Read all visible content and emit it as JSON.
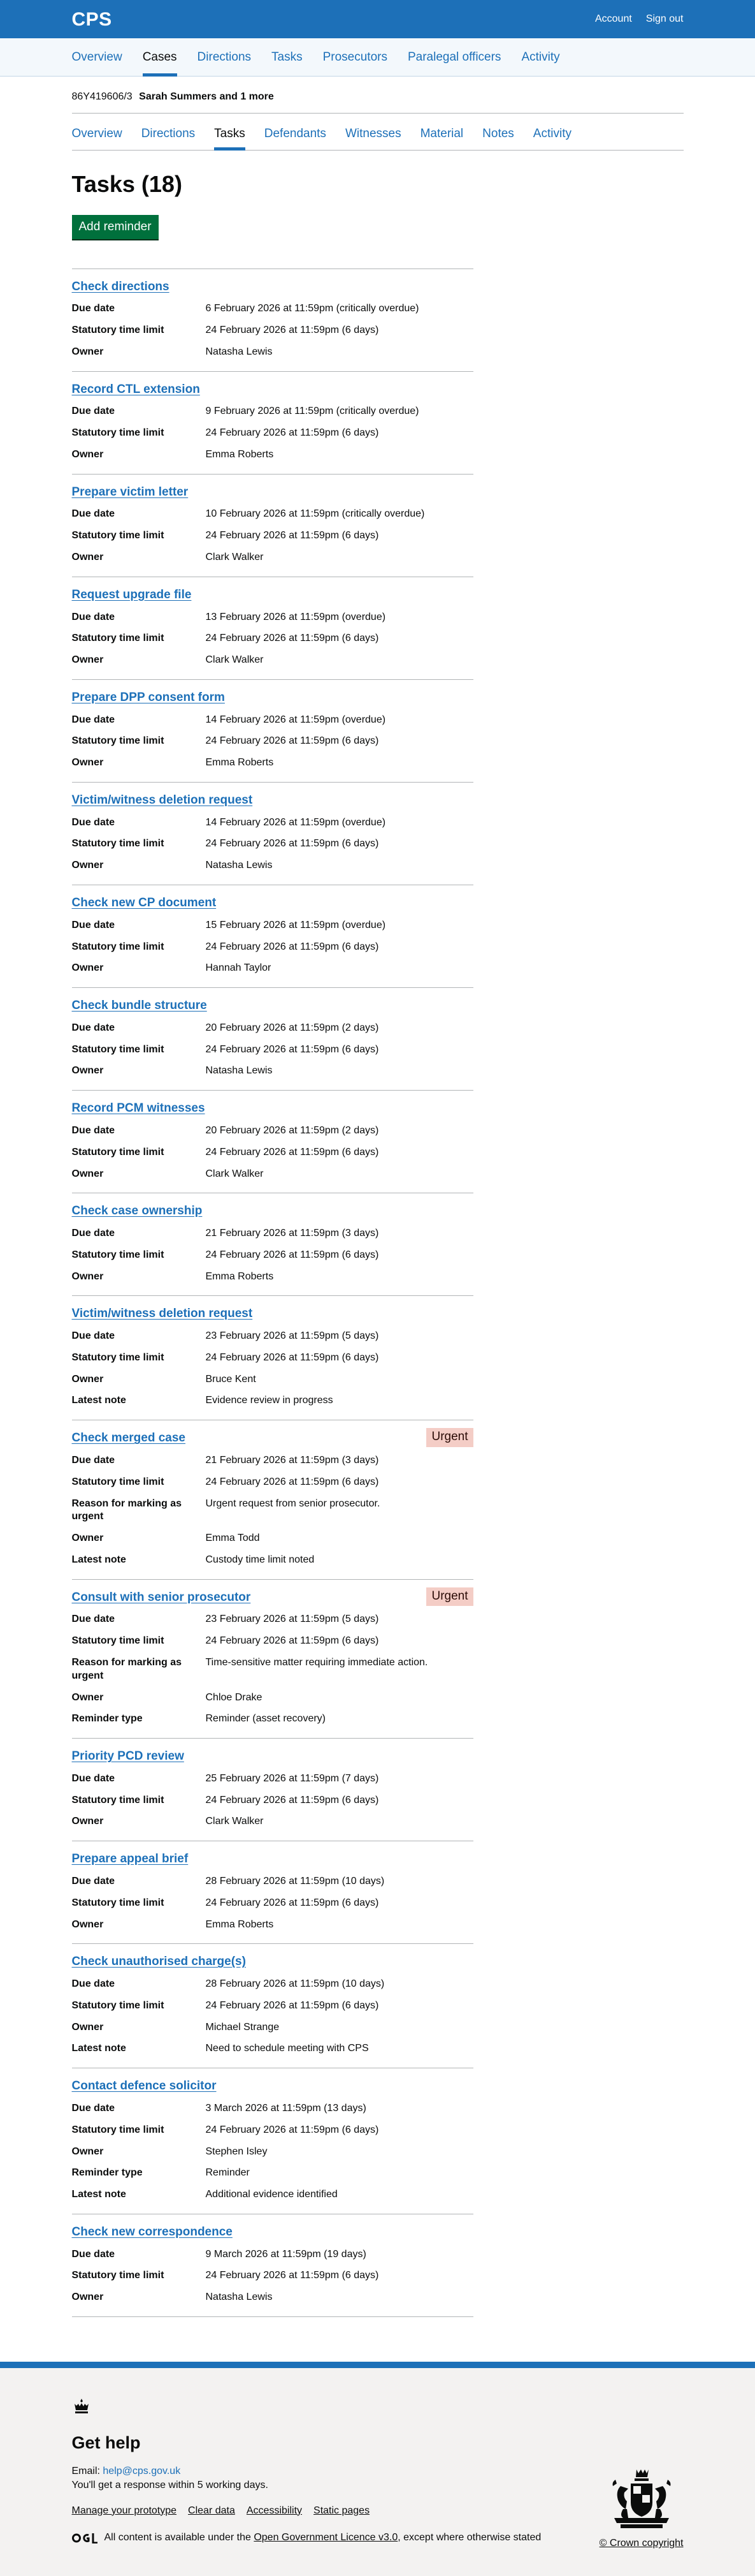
{
  "header": {
    "brand": "CPS",
    "links": [
      "Account",
      "Sign out"
    ]
  },
  "primary_nav": [
    {
      "label": "Overview",
      "active": false
    },
    {
      "label": "Cases",
      "active": true
    },
    {
      "label": "Directions",
      "active": false
    },
    {
      "label": "Tasks",
      "active": false
    },
    {
      "label": "Prosecutors",
      "active": false
    },
    {
      "label": "Paralegal officers",
      "active": false
    },
    {
      "label": "Activity",
      "active": false
    }
  ],
  "case": {
    "urn": "86Y419606/3",
    "name": "Sarah Summers and 1 more"
  },
  "secondary_nav": [
    {
      "label": "Overview",
      "active": false
    },
    {
      "label": "Directions",
      "active": false
    },
    {
      "label": "Tasks",
      "active": true
    },
    {
      "label": "Defendants",
      "active": false
    },
    {
      "label": "Witnesses",
      "active": false
    },
    {
      "label": "Material",
      "active": false
    },
    {
      "label": "Notes",
      "active": false
    },
    {
      "label": "Activity",
      "active": false
    }
  ],
  "page_title": "Tasks (18)",
  "add_button": "Add reminder",
  "tasks": [
    {
      "title": "Check directions",
      "rows": [
        {
          "k": "Due date",
          "v": "6 February 2026 at 11:59pm (critically overdue)"
        },
        {
          "k": "Statutory time limit",
          "v": "24 February 2026 at 11:59pm (6 days)"
        },
        {
          "k": "Owner",
          "v": "Natasha Lewis"
        }
      ]
    },
    {
      "title": "Record CTL extension",
      "rows": [
        {
          "k": "Due date",
          "v": "9 February 2026 at 11:59pm (critically overdue)"
        },
        {
          "k": "Statutory time limit",
          "v": "24 February 2026 at 11:59pm (6 days)"
        },
        {
          "k": "Owner",
          "v": "Emma Roberts"
        }
      ]
    },
    {
      "title": "Prepare victim letter",
      "rows": [
        {
          "k": "Due date",
          "v": "10 February 2026 at 11:59pm (critically overdue)"
        },
        {
          "k": "Statutory time limit",
          "v": "24 February 2026 at 11:59pm (6 days)"
        },
        {
          "k": "Owner",
          "v": "Clark Walker"
        }
      ]
    },
    {
      "title": "Request upgrade file",
      "rows": [
        {
          "k": "Due date",
          "v": "13 February 2026 at 11:59pm (overdue)"
        },
        {
          "k": "Statutory time limit",
          "v": "24 February 2026 at 11:59pm (6 days)"
        },
        {
          "k": "Owner",
          "v": "Clark Walker"
        }
      ]
    },
    {
      "title": "Prepare DPP consent form",
      "rows": [
        {
          "k": "Due date",
          "v": "14 February 2026 at 11:59pm (overdue)"
        },
        {
          "k": "Statutory time limit",
          "v": "24 February 2026 at 11:59pm (6 days)"
        },
        {
          "k": "Owner",
          "v": "Emma Roberts"
        }
      ]
    },
    {
      "title": "Victim/witness deletion request",
      "rows": [
        {
          "k": "Due date",
          "v": "14 February 2026 at 11:59pm (overdue)"
        },
        {
          "k": "Statutory time limit",
          "v": "24 February 2026 at 11:59pm (6 days)"
        },
        {
          "k": "Owner",
          "v": "Natasha Lewis"
        }
      ]
    },
    {
      "title": "Check new CP document",
      "rows": [
        {
          "k": "Due date",
          "v": "15 February 2026 at 11:59pm (overdue)"
        },
        {
          "k": "Statutory time limit",
          "v": "24 February 2026 at 11:59pm (6 days)"
        },
        {
          "k": "Owner",
          "v": "Hannah Taylor"
        }
      ]
    },
    {
      "title": "Check bundle structure",
      "rows": [
        {
          "k": "Due date",
          "v": "20 February 2026 at 11:59pm (2 days)"
        },
        {
          "k": "Statutory time limit",
          "v": "24 February 2026 at 11:59pm (6 days)"
        },
        {
          "k": "Owner",
          "v": "Natasha Lewis"
        }
      ]
    },
    {
      "title": "Record PCM witnesses",
      "rows": [
        {
          "k": "Due date",
          "v": "20 February 2026 at 11:59pm (2 days)"
        },
        {
          "k": "Statutory time limit",
          "v": "24 February 2026 at 11:59pm (6 days)"
        },
        {
          "k": "Owner",
          "v": "Clark Walker"
        }
      ]
    },
    {
      "title": "Check case ownership",
      "rows": [
        {
          "k": "Due date",
          "v": "21 February 2026 at 11:59pm (3 days)"
        },
        {
          "k": "Statutory time limit",
          "v": "24 February 2026 at 11:59pm (6 days)"
        },
        {
          "k": "Owner",
          "v": "Emma Roberts"
        }
      ]
    },
    {
      "title": "Victim/witness deletion request",
      "rows": [
        {
          "k": "Due date",
          "v": "23 February 2026 at 11:59pm (5 days)"
        },
        {
          "k": "Statutory time limit",
          "v": "24 February 2026 at 11:59pm (6 days)"
        },
        {
          "k": "Owner",
          "v": "Bruce Kent"
        },
        {
          "k": "Latest note",
          "v": "Evidence review in progress"
        }
      ]
    },
    {
      "title": "Check merged case",
      "tag": "Urgent",
      "rows": [
        {
          "k": "Due date",
          "v": "21 February 2026 at 11:59pm (3 days)"
        },
        {
          "k": "Statutory time limit",
          "v": "24 February 2026 at 11:59pm (6 days)"
        },
        {
          "k": "Reason for marking as urgent",
          "v": "Urgent request from senior prosecutor."
        },
        {
          "k": "Owner",
          "v": "Emma Todd"
        },
        {
          "k": "Latest note",
          "v": "Custody time limit noted"
        }
      ]
    },
    {
      "title": "Consult with senior prosecutor",
      "tag": "Urgent",
      "rows": [
        {
          "k": "Due date",
          "v": "23 February 2026 at 11:59pm (5 days)"
        },
        {
          "k": "Statutory time limit",
          "v": "24 February 2026 at 11:59pm (6 days)"
        },
        {
          "k": "Reason for marking as urgent",
          "v": "Time-sensitive matter requiring immediate action."
        },
        {
          "k": "Owner",
          "v": "Chloe Drake"
        },
        {
          "k": "Reminder type",
          "v": "Reminder (asset recovery)"
        }
      ]
    },
    {
      "title": "Priority PCD review",
      "rows": [
        {
          "k": "Due date",
          "v": "25 February 2026 at 11:59pm (7 days)"
        },
        {
          "k": "Statutory time limit",
          "v": "24 February 2026 at 11:59pm (6 days)"
        },
        {
          "k": "Owner",
          "v": "Clark Walker"
        }
      ]
    },
    {
      "title": "Prepare appeal brief",
      "rows": [
        {
          "k": "Due date",
          "v": "28 February 2026 at 11:59pm (10 days)"
        },
        {
          "k": "Statutory time limit",
          "v": "24 February 2026 at 11:59pm (6 days)"
        },
        {
          "k": "Owner",
          "v": "Emma Roberts"
        }
      ]
    },
    {
      "title": "Check unauthorised charge(s)",
      "rows": [
        {
          "k": "Due date",
          "v": "28 February 2026 at 11:59pm (10 days)"
        },
        {
          "k": "Statutory time limit",
          "v": "24 February 2026 at 11:59pm (6 days)"
        },
        {
          "k": "Owner",
          "v": "Michael Strange"
        },
        {
          "k": "Latest note",
          "v": "Need to schedule meeting with CPS"
        }
      ]
    },
    {
      "title": "Contact defence solicitor",
      "rows": [
        {
          "k": "Due date",
          "v": "3 March 2026 at 11:59pm (13 days)"
        },
        {
          "k": "Statutory time limit",
          "v": "24 February 2026 at 11:59pm (6 days)"
        },
        {
          "k": "Owner",
          "v": "Stephen Isley"
        },
        {
          "k": "Reminder type",
          "v": "Reminder"
        },
        {
          "k": "Latest note",
          "v": "Additional evidence identified"
        }
      ]
    },
    {
      "title": "Check new correspondence",
      "rows": [
        {
          "k": "Due date",
          "v": "9 March 2026 at 11:59pm (19 days)"
        },
        {
          "k": "Statutory time limit",
          "v": "24 February 2026 at 11:59pm (6 days)"
        },
        {
          "k": "Owner",
          "v": "Natasha Lewis"
        }
      ]
    }
  ],
  "footer": {
    "heading": "Get help",
    "email_label": "Email:",
    "email": "help@cps.gov.uk",
    "response": "You'll get a response within 5 working days.",
    "meta_links": [
      "Manage your prototype",
      "Clear data",
      "Accessibility",
      "Static pages"
    ],
    "licence_prefix": "All content is available under the",
    "licence_link": "Open Government Licence v3.0",
    "licence_suffix": ", except where otherwise stated",
    "copyright": "© Crown copyright"
  },
  "colors": {
    "brand_blue": "#1d70b8",
    "button_green": "#00703c",
    "urgent_tag_bg": "#f4cdc6"
  }
}
